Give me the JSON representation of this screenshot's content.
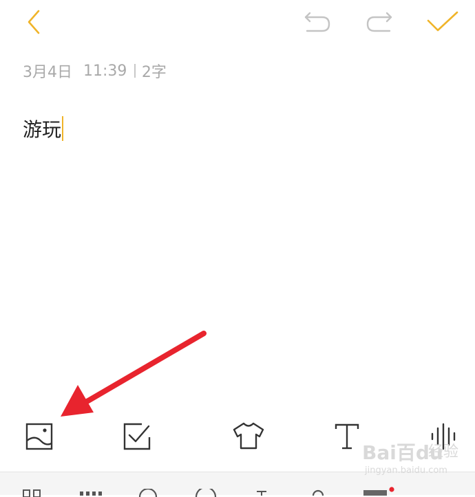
{
  "header": {
    "back_icon": "chevron-left-icon",
    "undo_icon": "undo-icon",
    "redo_icon": "redo-icon",
    "done_icon": "checkmark-icon"
  },
  "note": {
    "date": "3月4日",
    "time": "11:39",
    "word_count": "2字",
    "content": "游玩"
  },
  "toolbar": {
    "items": [
      {
        "icon": "image-icon"
      },
      {
        "icon": "checklist-icon"
      },
      {
        "icon": "shirt-icon"
      },
      {
        "icon": "text-format-icon"
      },
      {
        "icon": "voice-wave-icon"
      }
    ]
  },
  "watermark": {
    "logo": "Bai百du",
    "service": "经验",
    "url": "jingyan.baidu.com"
  },
  "colors": {
    "accent": "#f0b429",
    "disabled": "#c4c4c4",
    "meta_text": "#a9a9a9",
    "annotation_arrow": "#e8242e"
  }
}
